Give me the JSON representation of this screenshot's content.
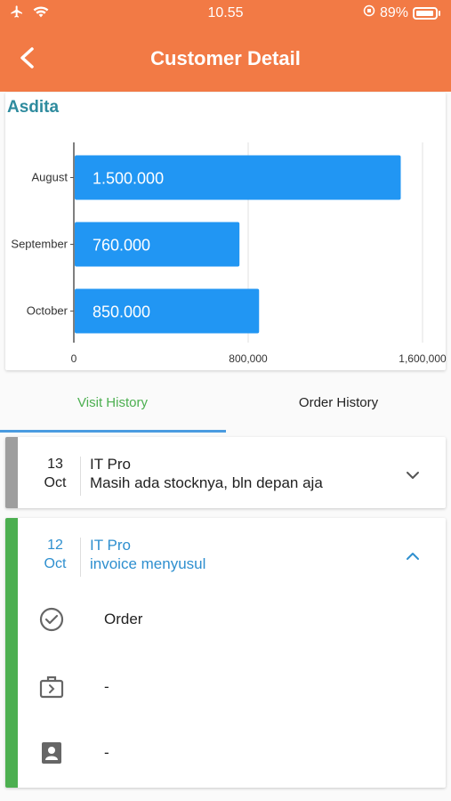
{
  "status_bar": {
    "time": "10.55",
    "battery": "89%"
  },
  "header": {
    "title": "Customer Detail"
  },
  "customer": {
    "name": "Asdita"
  },
  "chart_data": {
    "type": "bar",
    "orientation": "horizontal",
    "categories": [
      "August",
      "September",
      "October"
    ],
    "values": [
      1500000,
      760000,
      850000
    ],
    "value_labels": [
      "1.500.000",
      "760.000",
      "850.000"
    ],
    "x_ticks": [
      "0",
      "800,000",
      "1,600,000"
    ],
    "xlim": [
      0,
      1600000
    ],
    "bar_color": "#2196f3",
    "grid": true
  },
  "tabs": [
    {
      "label": "Visit History",
      "active": true
    },
    {
      "label": "Order History",
      "active": false
    }
  ],
  "visits": [
    {
      "day": "13",
      "month": "Oct",
      "company": "IT Pro",
      "note": "Masih ada stocknya, bln depan aja",
      "bar_color": "#9e9e9e",
      "expanded": false
    },
    {
      "day": "12",
      "month": "Oct",
      "company": "IT Pro",
      "note": "invoice menyusul",
      "bar_color": "#4caf50",
      "expanded": true,
      "details": [
        {
          "icon": "check-circle-icon",
          "value": "Order"
        },
        {
          "icon": "briefcase-icon",
          "value": "-"
        },
        {
          "icon": "contact-card-icon",
          "value": "-"
        }
      ]
    }
  ],
  "colors": {
    "header": "#f27a45",
    "accent_blue": "#2e8fcf",
    "accent_green": "#4caf50"
  }
}
